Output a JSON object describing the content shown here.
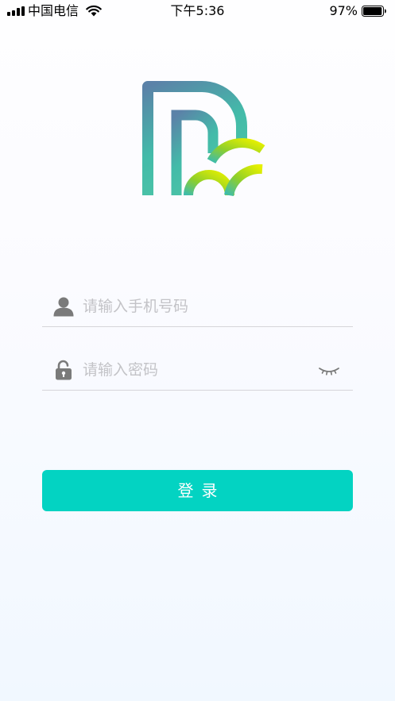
{
  "status_bar": {
    "carrier": "中国电信",
    "time": "下午5:36",
    "battery_percent": "97%",
    "battery_level": 0.97
  },
  "logo": {
    "name": "r-logo",
    "colors": [
      "#5b82a8",
      "#43bba9",
      "#8fcf2a",
      "#e6f000"
    ]
  },
  "form": {
    "phone": {
      "placeholder": "请输入手机号码",
      "icon": "user-icon",
      "value": ""
    },
    "password": {
      "placeholder": "请输入密码",
      "icon": "lock-icon",
      "toggle_icon": "eye-closed-icon",
      "value": ""
    },
    "login_label": "登录"
  },
  "colors": {
    "accent": "#03d3c2",
    "icon_gray": "#7a7a7a",
    "divider": "#d5d5d9",
    "placeholder": "#c3c3c7"
  }
}
